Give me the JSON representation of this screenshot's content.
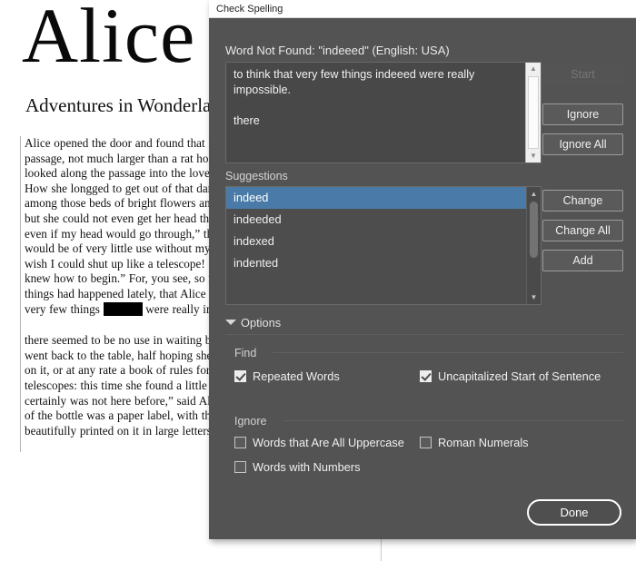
{
  "document": {
    "title": "Alice",
    "subtitle": "Adventures in Wonderland",
    "paragraph_1": "Alice opened the door and found that it led into a small passage, not much larger than a rat hole: she knelt down and looked along the passage into the loveliest garden you ever saw. How she longged to get out of that dark hall, and wander about among those beds of bright flowers and those cool fountains, but she could not even get her head through the doorway; “and even if my head would go through,” thought poor Alice, “it would be of very little use without my shoulders. Oh, how I wish I could shut up like a telescope! I think I could, if I only knew how to begin.” For, you see, so many out-of-the-way things had happened lately, that Alice had begun to think that very few things ",
    "paragraph_1_highlight": "indeeed",
    "paragraph_1_tail": " were really impossible.",
    "paragraph_2": "there seemed to be no use in waiting by the little door, so she went back to the table, half hoping she might find another key on it, or at any rate a book of rules for shutting people up like telescopes: this time she found a little bottle on it, (“which certainly was not here before,” said Alice,) and round the neck of the bottle was a paper label, with the words “DRINK ME,” beautifully printed on it in large letters."
  },
  "dialog": {
    "title": "Check Spelling",
    "word_not_found_label": "Word Not Found: \"indeeed\" (English: USA)",
    "context": {
      "line1": "to think that very few things indeeed were really",
      "line2": "impossible.",
      "line3": "there"
    },
    "buttons": {
      "start": "Start",
      "ignore": "Ignore",
      "ignore_all": "Ignore All",
      "change": "Change",
      "change_all": "Change All",
      "add": "Add",
      "done": "Done"
    },
    "suggestions_label": "Suggestions",
    "suggestions": [
      {
        "text": "indeed",
        "selected": true
      },
      {
        "text": "indeeded",
        "selected": false
      },
      {
        "text": "indexed",
        "selected": false
      },
      {
        "text": "indented",
        "selected": false
      }
    ],
    "options": {
      "header": "Options",
      "find_label": "Find",
      "ignore_label": "Ignore",
      "find_items": [
        {
          "label": "Repeated Words",
          "checked": true
        },
        {
          "label": "Uncapitalized Start of Sentence",
          "checked": true
        }
      ],
      "ignore_items": [
        {
          "label": "Words that Are All Uppercase",
          "checked": false
        },
        {
          "label": "Roman Numerals",
          "checked": false
        },
        {
          "label": "Words with Numbers",
          "checked": false
        }
      ]
    },
    "icons": {
      "disclosure": "triangle-down-icon",
      "scroll_up": "▲",
      "scroll_down": "▼"
    },
    "colors": {
      "dialog_bg": "#535353",
      "titlebar_bg": "#ffffff",
      "selection_blue": "#4a7ba8",
      "text_light": "#f0f0f0",
      "disabled_text": "#767676"
    }
  }
}
